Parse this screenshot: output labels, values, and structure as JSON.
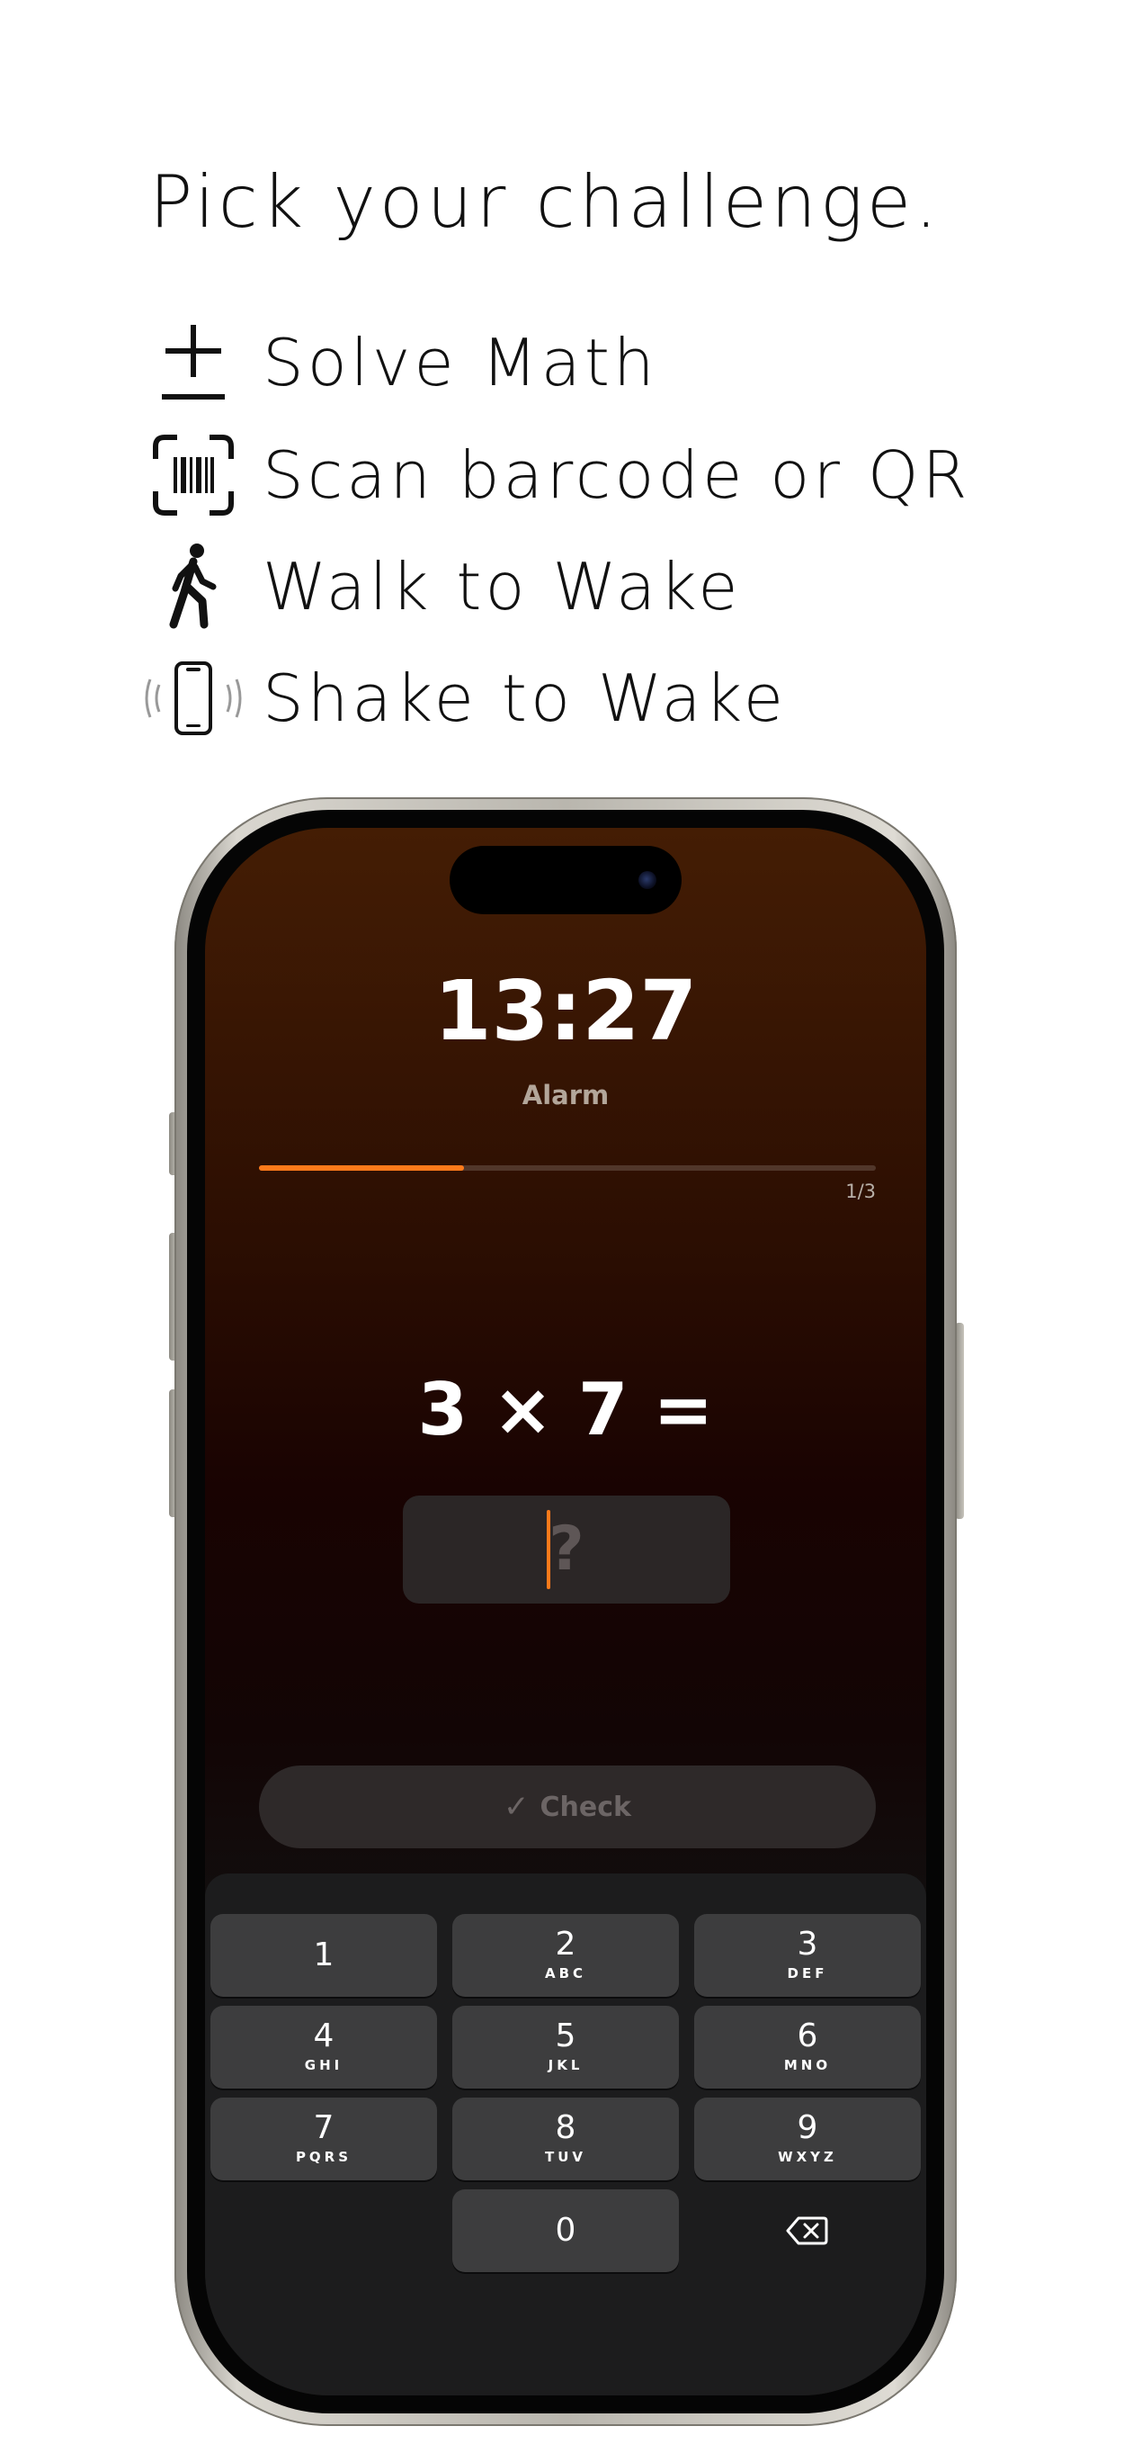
{
  "header": {
    "title": "Pick your challenge."
  },
  "features": [
    {
      "icon": "plus-minus-icon",
      "label": "Solve Math"
    },
    {
      "icon": "barcode-scan-icon",
      "label": "Scan barcode or QR"
    },
    {
      "icon": "walking-person-icon",
      "label": "Walk to Wake"
    },
    {
      "icon": "phone-shake-icon",
      "label": "Shake to Wake"
    }
  ],
  "alarm_screen": {
    "time": "13:27",
    "label": "Alarm",
    "progress": {
      "fraction": 0.333,
      "count_text": "1/3",
      "fill_color": "#ff7a1a"
    },
    "equation": "3 × 7 =",
    "answer": {
      "value": "",
      "placeholder": "?"
    },
    "check_button": {
      "label": "Check",
      "icon": "checkmark-icon"
    }
  },
  "keypad": {
    "keys": [
      {
        "digit": "1",
        "letters": ""
      },
      {
        "digit": "2",
        "letters": "ABC"
      },
      {
        "digit": "3",
        "letters": "DEF"
      },
      {
        "digit": "4",
        "letters": "GHI"
      },
      {
        "digit": "5",
        "letters": "JKL"
      },
      {
        "digit": "6",
        "letters": "MNO"
      },
      {
        "digit": "7",
        "letters": "PQRS"
      },
      {
        "digit": "8",
        "letters": "TUV"
      },
      {
        "digit": "9",
        "letters": "WXYZ"
      },
      {
        "digit": "0",
        "letters": ""
      }
    ],
    "delete_icon": "backspace-icon"
  }
}
